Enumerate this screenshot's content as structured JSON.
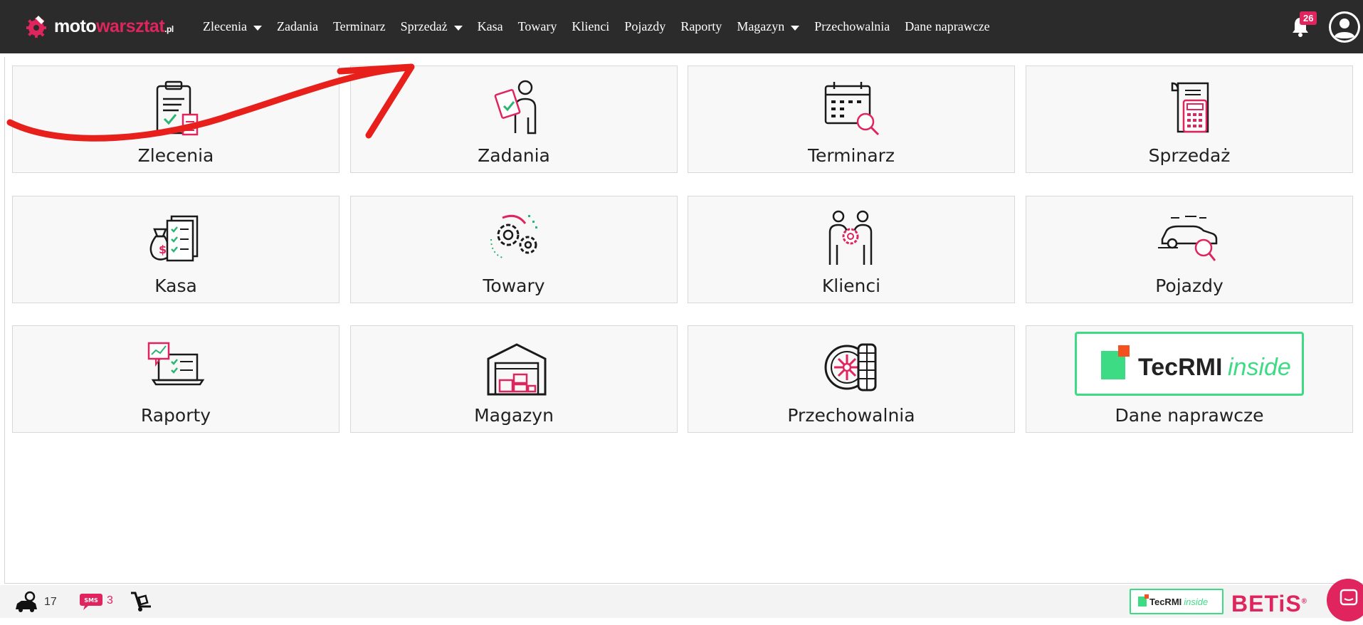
{
  "app": {
    "logo": {
      "part1": "moto",
      "part2": "warsztat",
      "part3": ".pl"
    }
  },
  "nav": {
    "items": [
      {
        "label": "Zlecenia",
        "dropdown": true
      },
      {
        "label": "Zadania",
        "dropdown": false
      },
      {
        "label": "Terminarz",
        "dropdown": false
      },
      {
        "label": "Sprzedaż",
        "dropdown": true
      },
      {
        "label": "Kasa",
        "dropdown": false
      },
      {
        "label": "Towary",
        "dropdown": false
      },
      {
        "label": "Klienci",
        "dropdown": false
      },
      {
        "label": "Pojazdy",
        "dropdown": false
      },
      {
        "label": "Raporty",
        "dropdown": false
      },
      {
        "label": "Magazyn",
        "dropdown": true
      },
      {
        "label": "Przechowalnia",
        "dropdown": false
      },
      {
        "label": "Dane naprawcze",
        "dropdown": false
      }
    ],
    "notifications_count": "26"
  },
  "tiles": [
    {
      "label": "Zlecenia",
      "icon": "clipboard-calculator-icon"
    },
    {
      "label": "Zadania",
      "icon": "person-clipboard-icon"
    },
    {
      "label": "Terminarz",
      "icon": "calendar-search-icon"
    },
    {
      "label": "Sprzedaż",
      "icon": "receipt-calculator-icon"
    },
    {
      "label": "Kasa",
      "icon": "money-bag-checklist-icon"
    },
    {
      "label": "Towary",
      "icon": "gears-icon"
    },
    {
      "label": "Klienci",
      "icon": "people-gear-icon"
    },
    {
      "label": "Pojazdy",
      "icon": "car-search-icon"
    },
    {
      "label": "Raporty",
      "icon": "laptop-chart-icon"
    },
    {
      "label": "Magazyn",
      "icon": "warehouse-icon"
    },
    {
      "label": "Przechowalnia",
      "icon": "wheel-tire-icon"
    },
    {
      "label": "Dane naprawcze",
      "icon": "tecrmi-logo",
      "logo_text1": "TecRMI",
      "logo_text2": "inside"
    }
  ],
  "statusbar": {
    "cars_count": "17",
    "sms_label": "SMS",
    "sms_count": "3",
    "tecrmi_text1": "TecRMI",
    "tecrmi_text2": "inside",
    "betis": "BETiS",
    "betis_mark": "®"
  },
  "colors": {
    "topbar": "#2b2b2b",
    "accent": "#e0245e",
    "tecrmi_green": "#3ddc84",
    "tile_bg": "#f8f8f8"
  }
}
